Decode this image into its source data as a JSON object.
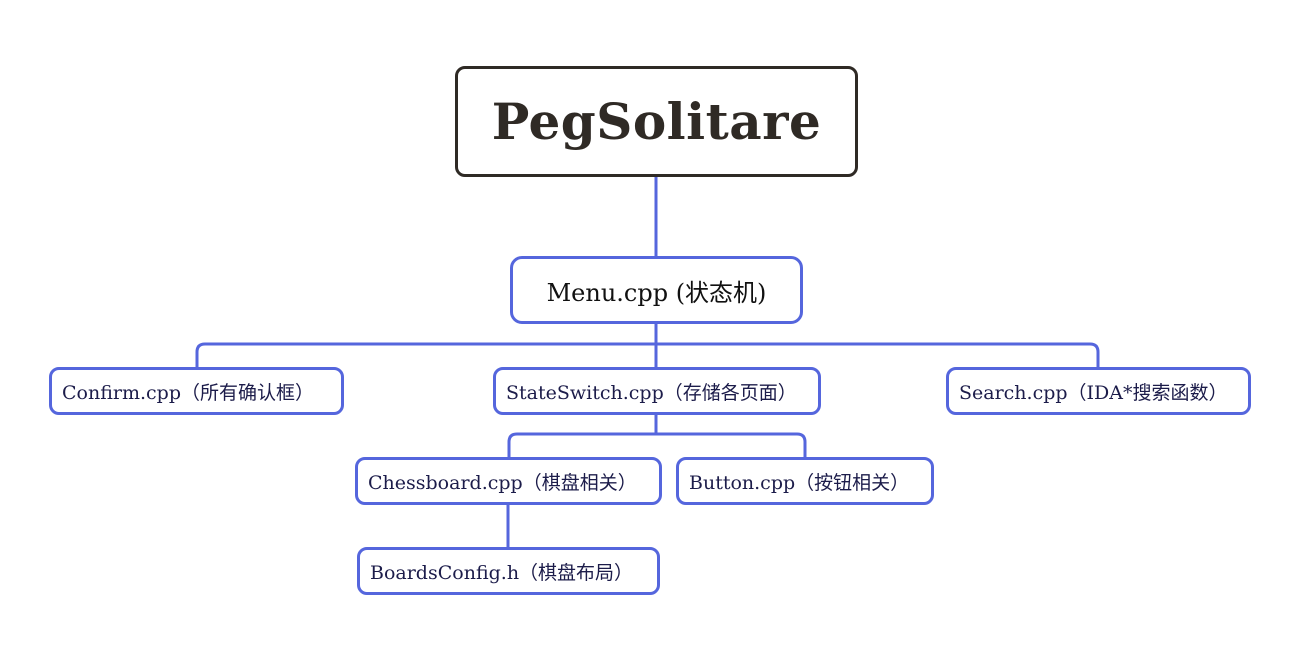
{
  "diagram": {
    "root": {
      "label": "PegSolitare"
    },
    "menu": {
      "label": "Menu.cpp (状态机)"
    },
    "confirm": {
      "label": "Confirm.cpp（所有确认框）"
    },
    "state_switch": {
      "label": "StateSwitch.cpp（存储各页面）"
    },
    "search": {
      "label": "Search.cpp（IDA*搜索函数）"
    },
    "chessboard": {
      "label": "Chessboard.cpp（棋盘相关）"
    },
    "button": {
      "label": "Button.cpp（按钮相关）"
    },
    "boards_config": {
      "label": "BoardsConfig.h（棋盘布局）"
    }
  },
  "colors": {
    "root_border": "#2f2a25",
    "node_border": "#5566dd",
    "connector": "#5566dd"
  }
}
